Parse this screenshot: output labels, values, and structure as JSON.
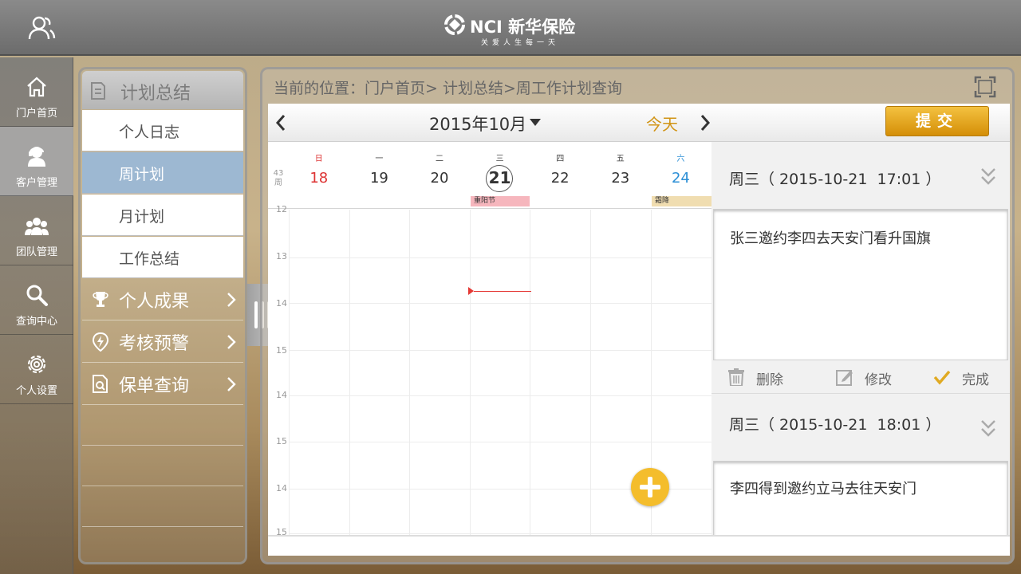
{
  "header": {
    "brand": "NCI 新华保险",
    "slogan": "关爱人生每一天"
  },
  "leftnav": {
    "items": [
      {
        "label": "门户首页",
        "icon": "home-icon"
      },
      {
        "label": "客户管理",
        "icon": "customer-icon",
        "active": true
      },
      {
        "label": "团队管理",
        "icon": "team-icon"
      },
      {
        "label": "查询中心",
        "icon": "search-icon"
      },
      {
        "label": "个人设置",
        "icon": "gear-icon"
      }
    ]
  },
  "submenu": {
    "header": "计划总结",
    "items": [
      {
        "label": "个人日志"
      },
      {
        "label": "周计划",
        "active": true
      },
      {
        "label": "月计划"
      },
      {
        "label": "工作总结"
      }
    ],
    "groups": [
      {
        "label": "个人成果",
        "icon": "trophy-icon"
      },
      {
        "label": "考核预警",
        "icon": "warning-icon"
      },
      {
        "label": "保单查询",
        "icon": "policy-search-icon"
      }
    ]
  },
  "main": {
    "breadcrumb": "当前的位置：门户首页> 计划总结>周工作计划查询",
    "month": "2015年10月",
    "today_label": "今天",
    "submit_label": "提交"
  },
  "calendar": {
    "week_number": "43",
    "week_unit": "周",
    "days": [
      {
        "weekday": "日",
        "date": "18"
      },
      {
        "weekday": "一",
        "date": "19"
      },
      {
        "weekday": "二",
        "date": "20"
      },
      {
        "weekday": "三",
        "date": "21"
      },
      {
        "weekday": "四",
        "date": "22"
      },
      {
        "weekday": "五",
        "date": "23"
      },
      {
        "weekday": "六",
        "date": "24"
      }
    ],
    "holidays": [
      {
        "label": "重阳节",
        "color": "#f6b6bd"
      },
      {
        "label": "霜降",
        "color": "#f0ddb0"
      }
    ],
    "hour_labels": [
      "12",
      "13",
      "14",
      "15",
      "14",
      "15",
      "14",
      "15"
    ]
  },
  "plans": [
    {
      "title": "周三（ 2015-10-21  17:01 ）",
      "content": "张三邀约李四去天安门看升国旗",
      "actions": {
        "delete": "删除",
        "edit": "修改",
        "done": "完成"
      }
    },
    {
      "title": "周三（ 2015-10-21  18:01 ）",
      "content": "李四得到邀约立马去往天安门"
    }
  ],
  "colors": {
    "accent": "#f4bd2c",
    "today_text": "#d19415",
    "sunday": "#dd3333",
    "saturday": "#2c8fd6",
    "active_menu": "#9db8d2"
  }
}
